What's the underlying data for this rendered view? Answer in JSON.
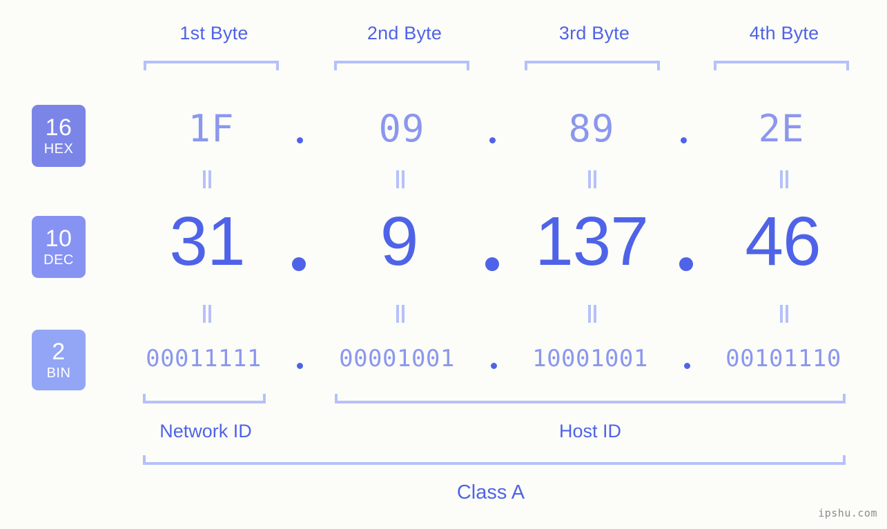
{
  "meta": {
    "watermark": "ipshu.com",
    "background_color": "#fcfdf8",
    "accent_color": "#4f63e8",
    "light_accent_color": "#8b97ee",
    "bracket_color": "#b6c0fb"
  },
  "byte_headers": [
    {
      "label": "1st Byte"
    },
    {
      "label": "2nd Byte"
    },
    {
      "label": "3rd Byte"
    },
    {
      "label": "4th Byte"
    }
  ],
  "bases": [
    {
      "number": "16",
      "name": "HEX",
      "color": "#7b85e8"
    },
    {
      "number": "10",
      "name": "DEC",
      "color": "#8793f2"
    },
    {
      "number": "2",
      "name": "BIN",
      "color": "#93a6f5"
    }
  ],
  "rows": {
    "hex": {
      "base_number": "16",
      "base_name": "HEX",
      "values": [
        "1F",
        "09",
        "89",
        "2E"
      ],
      "separator": "."
    },
    "dec": {
      "base_number": "10",
      "base_name": "DEC",
      "values": [
        "31",
        "9",
        "137",
        "46"
      ],
      "separator": "."
    },
    "bin": {
      "base_number": "2",
      "base_name": "BIN",
      "values": [
        "00011111",
        "00001001",
        "10001001",
        "00101110"
      ],
      "separator": "."
    }
  },
  "equality_marks": {
    "symbol": "=",
    "count_per_gap": 4
  },
  "sections": {
    "network_id": "Network ID",
    "host_id": "Host ID",
    "ip_class": "Class A"
  }
}
